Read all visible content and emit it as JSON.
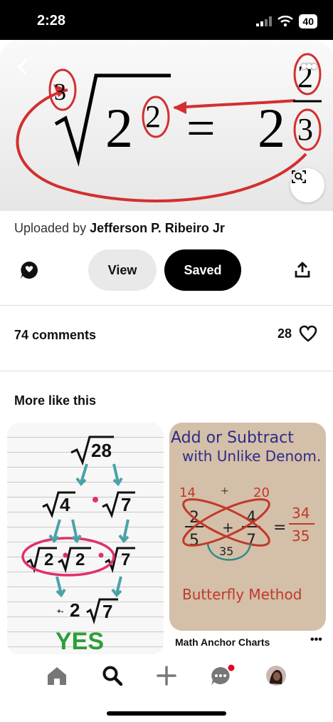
{
  "status_bar": {
    "time": "2:28",
    "battery": "40"
  },
  "hero": {
    "equation_index": "3",
    "equation_base": "2",
    "equation_exponent": "2",
    "equation_equals": "=",
    "equation_rhs_base": "2",
    "equation_rhs_numerator": "2",
    "equation_rhs_denominator": "3"
  },
  "pin": {
    "uploaded_prefix": "Uploaded by",
    "uploader": "Jefferson P. Ribeiro Jr",
    "view_label": "View",
    "saved_label": "Saved",
    "comments_label": "74 comments",
    "likes_count": "28"
  },
  "more_like_this": {
    "title": "More like this",
    "left_card": {
      "yes_text": "YES"
    },
    "right_card": {
      "line1": "Add or Subtract",
      "line2": "with Unlike Denom.",
      "footer": "Butterfly Method",
      "title": "Math Anchor Charts",
      "more": "•••"
    }
  },
  "icons": {
    "back": "chevron-left-icon",
    "more": "more-dots-icon",
    "lens": "visual-search-icon",
    "comment": "comment-icon",
    "share": "share-icon",
    "heart": "heart-icon",
    "home": "home-icon",
    "search": "search-icon",
    "create": "plus-icon",
    "messages": "messages-icon",
    "profile": "avatar"
  },
  "colors": {
    "accent_red": "#d32f2f",
    "saved_bg": "#000000",
    "view_bg": "#e9e9e9",
    "notification": "#e60023"
  }
}
